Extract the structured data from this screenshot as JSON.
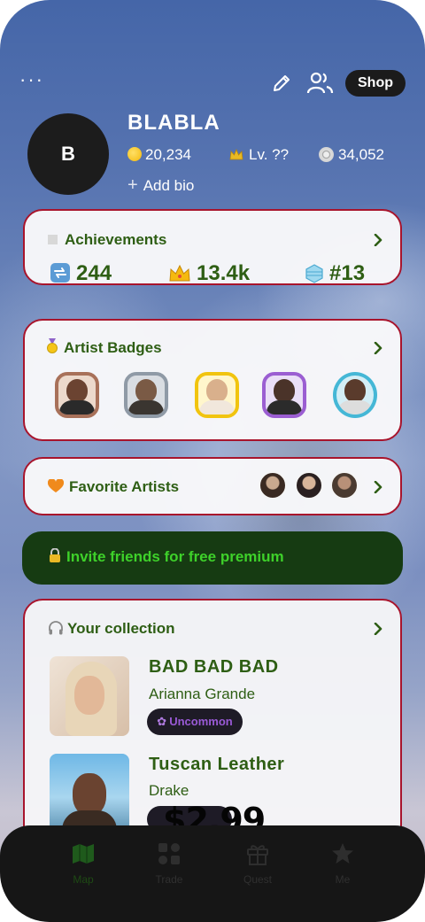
{
  "header": {
    "more_label": "···",
    "shop_label": "Shop"
  },
  "profile": {
    "avatar_initial": "B",
    "username": "BLABLA",
    "coins": "20,234",
    "level": "Lv. ??",
    "discs": "34,052",
    "add_bio_label": "Add bio"
  },
  "achievements": {
    "title": "Achievements",
    "streak": "244",
    "crowns": "13.4k",
    "rank": "#13"
  },
  "artist_badges": {
    "title": "Artist Badges",
    "badges": [
      {
        "border": "#a8715a"
      },
      {
        "border": "#8f9aa6"
      },
      {
        "border": "#f1c40f"
      },
      {
        "border": "#9b5ed2"
      },
      {
        "border": "#45b7d6"
      }
    ]
  },
  "favorite_artists": {
    "title": "Favorite Artists"
  },
  "invite": {
    "label": "Invite friends for free premium"
  },
  "collection": {
    "title": "Your collection",
    "items": [
      {
        "title": "BAD BAD BAD",
        "artist": "Arianna Grande",
        "rarity": "Uncommon"
      },
      {
        "title": "Tuscan Leather",
        "artist": "Drake"
      }
    ]
  },
  "price_overlay": "$2.99",
  "tabs": [
    {
      "label": "Map",
      "active": true
    },
    {
      "label": "Trade",
      "active": false
    },
    {
      "label": "Quest",
      "active": false
    },
    {
      "label": "Me",
      "active": false
    }
  ],
  "colors": {
    "card_border": "#a8142c",
    "accent_green": "#2e5e14",
    "invite_bg": "#163b12",
    "invite_text": "#3ed12a",
    "rarity_text": "#9a5ad6"
  }
}
